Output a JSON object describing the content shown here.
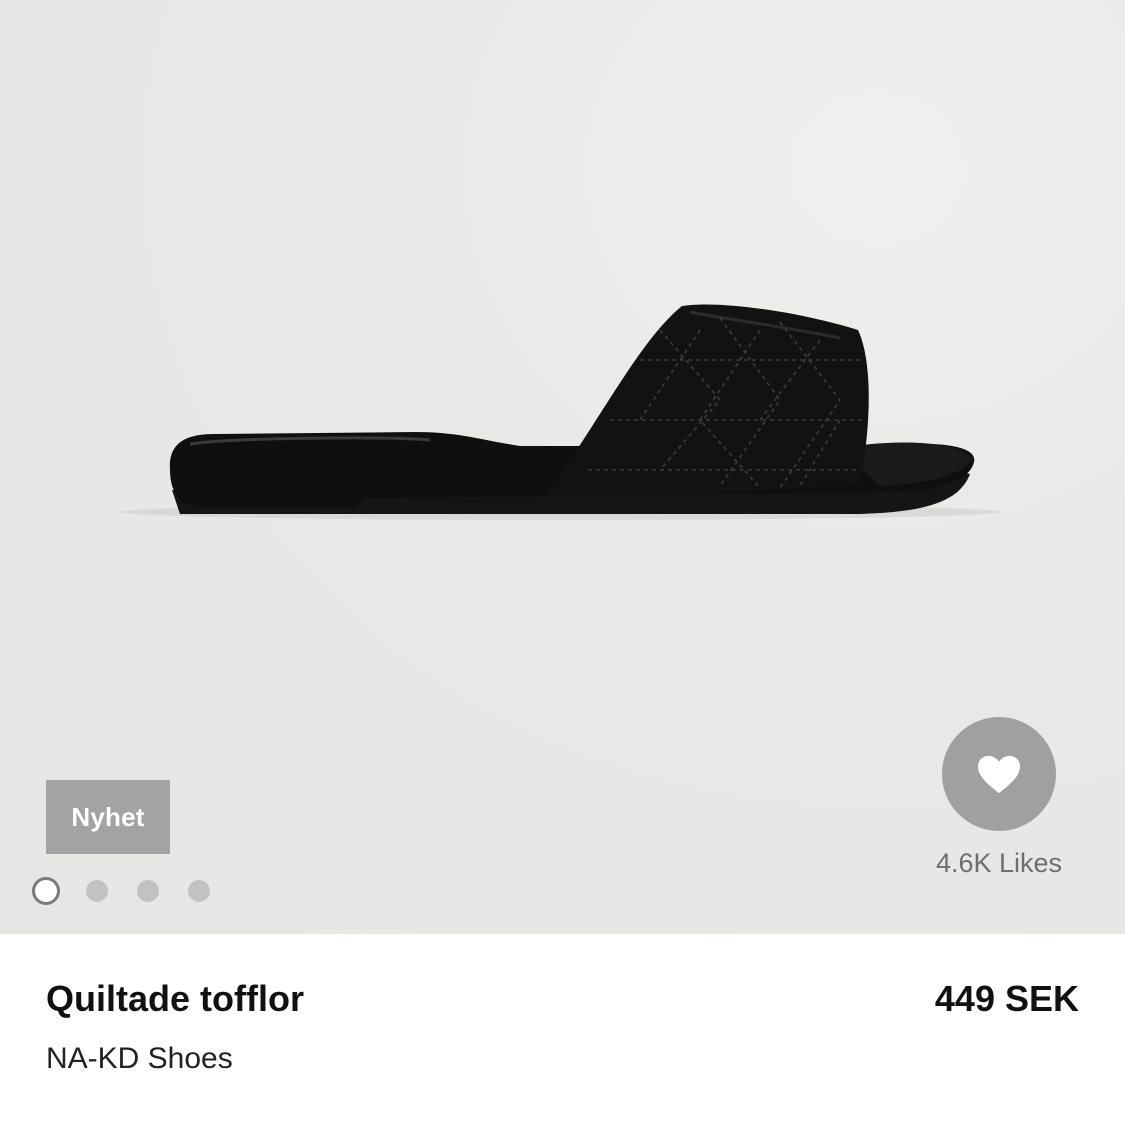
{
  "product": {
    "badge": "Nyhet",
    "likes": "4.6K Likes",
    "name": "Quiltade tofflor",
    "brand": "NA-KD Shoes",
    "price": "449 SEK",
    "image_count": 4,
    "active_image_index": 0
  },
  "icons": {
    "like": "heart-icon"
  },
  "colors": {
    "badge_bg": "#a3a3a3",
    "like_button_bg": "#a0a0a0",
    "image_bg": "#e8e8e6",
    "sandal": "#111111"
  }
}
